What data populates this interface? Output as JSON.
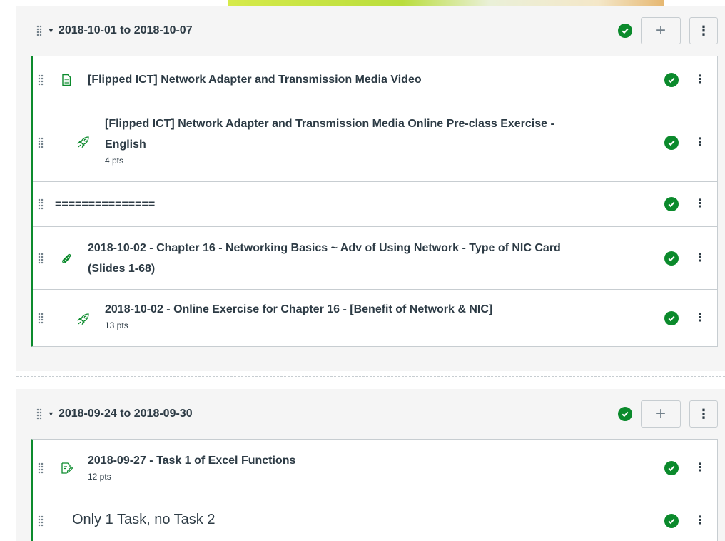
{
  "colors": {
    "accent_green": "#0b8a2c",
    "border": "#c7cdd1",
    "text": "#2d3b45",
    "icon_green": "#0b8a2c"
  },
  "modules": [
    {
      "title": "2018-10-01 to 2018-10-07",
      "add_label": "+",
      "menu_label": "⋮",
      "items": [
        {
          "icon": "page-icon",
          "title": "[Flipped ICT] Network Adapter and Transmission Media Video",
          "pts": ""
        },
        {
          "icon": "quiz-rocket-icon",
          "title": "[Flipped ICT] Network Adapter and Transmission Media Online Pre-class Exercise -",
          "title2": "English",
          "pts": "4 pts"
        },
        {
          "icon": "",
          "title": "===============",
          "pts": ""
        },
        {
          "icon": "attachment-icon",
          "title": "2018-10-02 - Chapter 16 - Networking Basics ~ Adv of Using Network - Type of NIC Card",
          "title2": "(Slides 1-68)",
          "pts": ""
        },
        {
          "icon": "quiz-rocket-icon",
          "title": "2018-10-02 - Online Exercise for Chapter 16 - [Benefit of Network & NIC]",
          "pts": "13 pts"
        }
      ]
    },
    {
      "title": "2018-09-24 to 2018-09-30",
      "add_label": "+",
      "menu_label": "⋮",
      "items": [
        {
          "icon": "assignment-icon",
          "title": "2018-09-27 - Task 1 of Excel Functions",
          "pts": "12 pts"
        },
        {
          "icon": "",
          "title": "Only 1 Task, no Task 2",
          "pts": ""
        }
      ]
    }
  ],
  "item_menu_label": "⋮"
}
